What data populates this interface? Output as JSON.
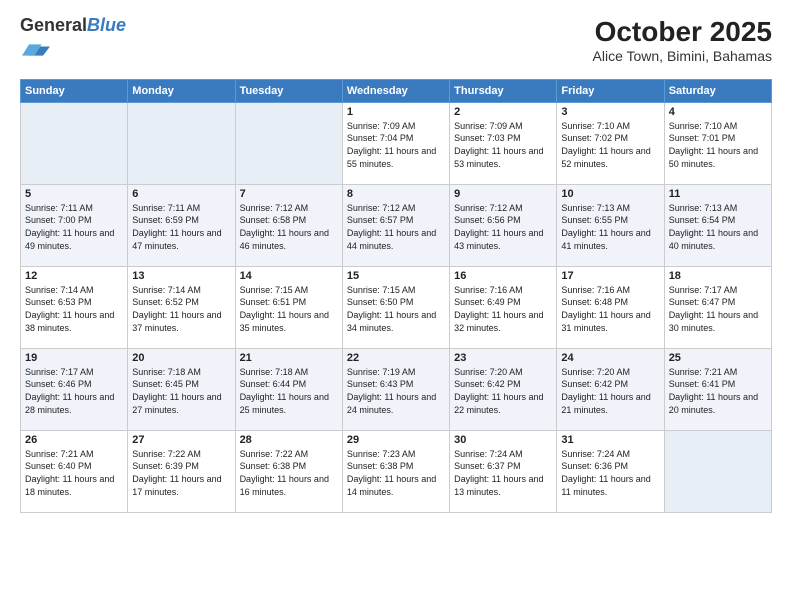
{
  "logo": {
    "general": "General",
    "blue": "Blue"
  },
  "title": "October 2025",
  "subtitle": "Alice Town, Bimini, Bahamas",
  "days_of_week": [
    "Sunday",
    "Monday",
    "Tuesday",
    "Wednesday",
    "Thursday",
    "Friday",
    "Saturday"
  ],
  "weeks": [
    [
      {
        "day": "",
        "info": ""
      },
      {
        "day": "",
        "info": ""
      },
      {
        "day": "",
        "info": ""
      },
      {
        "day": "1",
        "info": "Sunrise: 7:09 AM\nSunset: 7:04 PM\nDaylight: 11 hours and 55 minutes."
      },
      {
        "day": "2",
        "info": "Sunrise: 7:09 AM\nSunset: 7:03 PM\nDaylight: 11 hours and 53 minutes."
      },
      {
        "day": "3",
        "info": "Sunrise: 7:10 AM\nSunset: 7:02 PM\nDaylight: 11 hours and 52 minutes."
      },
      {
        "day": "4",
        "info": "Sunrise: 7:10 AM\nSunset: 7:01 PM\nDaylight: 11 hours and 50 minutes."
      }
    ],
    [
      {
        "day": "5",
        "info": "Sunrise: 7:11 AM\nSunset: 7:00 PM\nDaylight: 11 hours and 49 minutes."
      },
      {
        "day": "6",
        "info": "Sunrise: 7:11 AM\nSunset: 6:59 PM\nDaylight: 11 hours and 47 minutes."
      },
      {
        "day": "7",
        "info": "Sunrise: 7:12 AM\nSunset: 6:58 PM\nDaylight: 11 hours and 46 minutes."
      },
      {
        "day": "8",
        "info": "Sunrise: 7:12 AM\nSunset: 6:57 PM\nDaylight: 11 hours and 44 minutes."
      },
      {
        "day": "9",
        "info": "Sunrise: 7:12 AM\nSunset: 6:56 PM\nDaylight: 11 hours and 43 minutes."
      },
      {
        "day": "10",
        "info": "Sunrise: 7:13 AM\nSunset: 6:55 PM\nDaylight: 11 hours and 41 minutes."
      },
      {
        "day": "11",
        "info": "Sunrise: 7:13 AM\nSunset: 6:54 PM\nDaylight: 11 hours and 40 minutes."
      }
    ],
    [
      {
        "day": "12",
        "info": "Sunrise: 7:14 AM\nSunset: 6:53 PM\nDaylight: 11 hours and 38 minutes."
      },
      {
        "day": "13",
        "info": "Sunrise: 7:14 AM\nSunset: 6:52 PM\nDaylight: 11 hours and 37 minutes."
      },
      {
        "day": "14",
        "info": "Sunrise: 7:15 AM\nSunset: 6:51 PM\nDaylight: 11 hours and 35 minutes."
      },
      {
        "day": "15",
        "info": "Sunrise: 7:15 AM\nSunset: 6:50 PM\nDaylight: 11 hours and 34 minutes."
      },
      {
        "day": "16",
        "info": "Sunrise: 7:16 AM\nSunset: 6:49 PM\nDaylight: 11 hours and 32 minutes."
      },
      {
        "day": "17",
        "info": "Sunrise: 7:16 AM\nSunset: 6:48 PM\nDaylight: 11 hours and 31 minutes."
      },
      {
        "day": "18",
        "info": "Sunrise: 7:17 AM\nSunset: 6:47 PM\nDaylight: 11 hours and 30 minutes."
      }
    ],
    [
      {
        "day": "19",
        "info": "Sunrise: 7:17 AM\nSunset: 6:46 PM\nDaylight: 11 hours and 28 minutes."
      },
      {
        "day": "20",
        "info": "Sunrise: 7:18 AM\nSunset: 6:45 PM\nDaylight: 11 hours and 27 minutes."
      },
      {
        "day": "21",
        "info": "Sunrise: 7:18 AM\nSunset: 6:44 PM\nDaylight: 11 hours and 25 minutes."
      },
      {
        "day": "22",
        "info": "Sunrise: 7:19 AM\nSunset: 6:43 PM\nDaylight: 11 hours and 24 minutes."
      },
      {
        "day": "23",
        "info": "Sunrise: 7:20 AM\nSunset: 6:42 PM\nDaylight: 11 hours and 22 minutes."
      },
      {
        "day": "24",
        "info": "Sunrise: 7:20 AM\nSunset: 6:42 PM\nDaylight: 11 hours and 21 minutes."
      },
      {
        "day": "25",
        "info": "Sunrise: 7:21 AM\nSunset: 6:41 PM\nDaylight: 11 hours and 20 minutes."
      }
    ],
    [
      {
        "day": "26",
        "info": "Sunrise: 7:21 AM\nSunset: 6:40 PM\nDaylight: 11 hours and 18 minutes."
      },
      {
        "day": "27",
        "info": "Sunrise: 7:22 AM\nSunset: 6:39 PM\nDaylight: 11 hours and 17 minutes."
      },
      {
        "day": "28",
        "info": "Sunrise: 7:22 AM\nSunset: 6:38 PM\nDaylight: 11 hours and 16 minutes."
      },
      {
        "day": "29",
        "info": "Sunrise: 7:23 AM\nSunset: 6:38 PM\nDaylight: 11 hours and 14 minutes."
      },
      {
        "day": "30",
        "info": "Sunrise: 7:24 AM\nSunset: 6:37 PM\nDaylight: 11 hours and 13 minutes."
      },
      {
        "day": "31",
        "info": "Sunrise: 7:24 AM\nSunset: 6:36 PM\nDaylight: 11 hours and 11 minutes."
      },
      {
        "day": "",
        "info": ""
      }
    ]
  ]
}
